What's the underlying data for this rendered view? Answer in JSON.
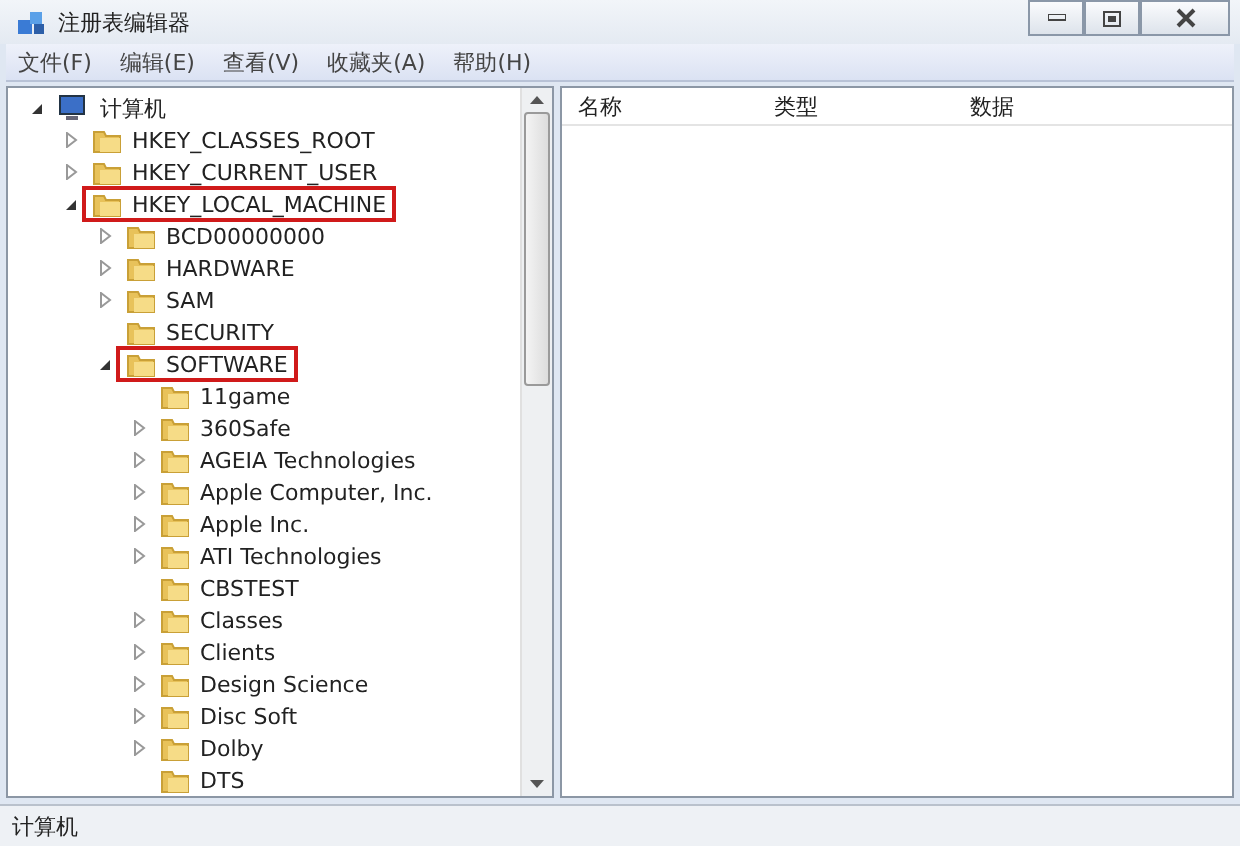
{
  "window": {
    "title": "注册表编辑器"
  },
  "menu": [
    "文件(F)",
    "编辑(E)",
    "查看(V)",
    "收藏夹(A)",
    "帮助(H)"
  ],
  "tree": [
    {
      "label": "计算机",
      "kind": "computer",
      "expanded": true,
      "highlighted": false,
      "children": [
        {
          "label": "HKEY_CLASSES_ROOT",
          "kind": "folder",
          "expanded": false,
          "highlighted": false
        },
        {
          "label": "HKEY_CURRENT_USER",
          "kind": "folder",
          "expanded": false,
          "highlighted": false
        },
        {
          "label": "HKEY_LOCAL_MACHINE",
          "kind": "folder",
          "expanded": true,
          "highlighted": true,
          "children": [
            {
              "label": "BCD00000000",
              "kind": "folder",
              "expanded": false,
              "highlighted": false
            },
            {
              "label": "HARDWARE",
              "kind": "folder",
              "expanded": false,
              "highlighted": false
            },
            {
              "label": "SAM",
              "kind": "folder",
              "expanded": false,
              "highlighted": false
            },
            {
              "label": "SECURITY",
              "kind": "folder",
              "highlighted": false
            },
            {
              "label": "SOFTWARE",
              "kind": "folder",
              "expanded": true,
              "highlighted": true,
              "children": [
                {
                  "label": "11game",
                  "kind": "folder",
                  "highlighted": false
                },
                {
                  "label": "360Safe",
                  "kind": "folder",
                  "expanded": false,
                  "highlighted": false
                },
                {
                  "label": "AGEIA Technologies",
                  "kind": "folder",
                  "expanded": false,
                  "highlighted": false
                },
                {
                  "label": "Apple Computer, Inc.",
                  "kind": "folder",
                  "expanded": false,
                  "highlighted": false
                },
                {
                  "label": "Apple Inc.",
                  "kind": "folder",
                  "expanded": false,
                  "highlighted": false
                },
                {
                  "label": "ATI Technologies",
                  "kind": "folder",
                  "expanded": false,
                  "highlighted": false
                },
                {
                  "label": "CBSTEST",
                  "kind": "folder",
                  "highlighted": false
                },
                {
                  "label": "Classes",
                  "kind": "folder",
                  "expanded": false,
                  "highlighted": false
                },
                {
                  "label": "Clients",
                  "kind": "folder",
                  "expanded": false,
                  "highlighted": false
                },
                {
                  "label": "Design Science",
                  "kind": "folder",
                  "expanded": false,
                  "highlighted": false
                },
                {
                  "label": "Disc Soft",
                  "kind": "folder",
                  "expanded": false,
                  "highlighted": false
                },
                {
                  "label": "Dolby",
                  "kind": "folder",
                  "expanded": false,
                  "highlighted": false
                },
                {
                  "label": "DTS",
                  "kind": "folder",
                  "highlighted": false
                }
              ]
            }
          ]
        }
      ]
    }
  ],
  "list": {
    "columns": [
      "名称",
      "类型",
      "数据"
    ]
  },
  "status_bar": "计算机"
}
